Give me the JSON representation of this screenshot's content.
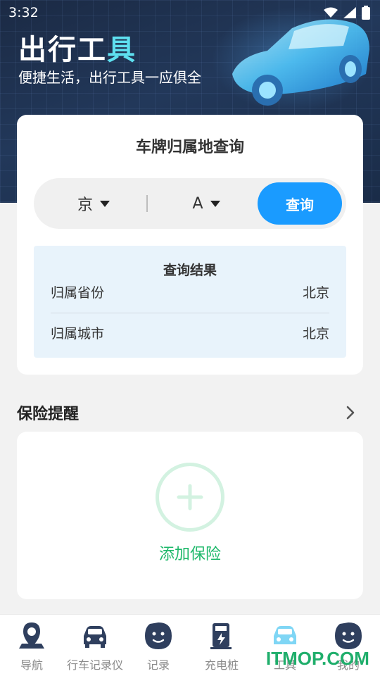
{
  "status_bar": {
    "time": "3:32"
  },
  "header": {
    "title_main": "出行工",
    "title_accent": "具",
    "subtitle": "便捷生活，出行工具一应俱全"
  },
  "plate_query": {
    "title": "车牌归属地查询",
    "province": "京",
    "letter": "A",
    "query_button": "查询",
    "result": {
      "title": "查询结果",
      "rows": [
        {
          "label": "归属省份",
          "value": "北京"
        },
        {
          "label": "归属城市",
          "value": "北京"
        }
      ]
    }
  },
  "insurance": {
    "title": "保险提醒",
    "add_label": "添加保险"
  },
  "tabbar": {
    "items": [
      {
        "label": "导航",
        "icon": "location-pin-icon"
      },
      {
        "label": "行车记录仪",
        "icon": "car-dashcam-icon"
      },
      {
        "label": "记录",
        "icon": "record-bubble-icon"
      },
      {
        "label": "充电桩",
        "icon": "charging-station-icon"
      },
      {
        "label": "工具",
        "icon": "car-tools-icon"
      },
      {
        "label": "我的",
        "icon": "profile-bubble-icon"
      }
    ],
    "active_index": 4
  },
  "watermark": "ITMOP.COM",
  "colors": {
    "accent_blue": "#1a9bff",
    "accent_green": "#1db86a",
    "header_bg": "#1b2a44",
    "tab_icon": "#2f3f5e",
    "tab_active": "#7fd6f5"
  }
}
